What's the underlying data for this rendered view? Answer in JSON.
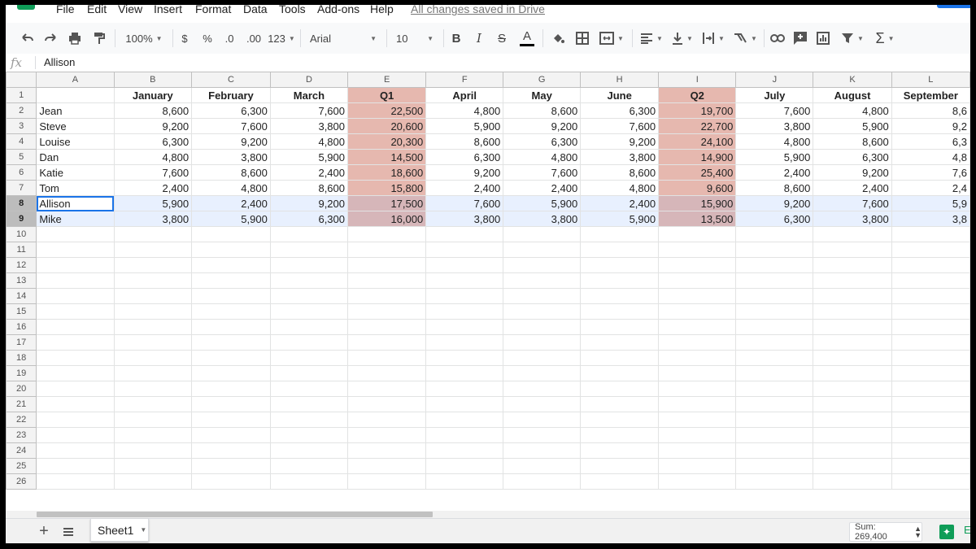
{
  "menu": [
    "File",
    "Edit",
    "View",
    "Insert",
    "Format",
    "Data",
    "Tools",
    "Add-ons",
    "Help"
  ],
  "saved_status": "All changes saved in Drive",
  "toolbar": {
    "zoom": "100%",
    "currency": "$",
    "percent": "%",
    "dec_decrease": ".0",
    "dec_increase": ".00",
    "more_formats": "123",
    "font": "Arial",
    "font_size": "10",
    "bold": "B",
    "italic": "I",
    "strike": "S",
    "text_color": "A",
    "sigma": "Σ"
  },
  "formula_bar": {
    "fx": "fx",
    "value": "Allison"
  },
  "columns": [
    "A",
    "B",
    "C",
    "D",
    "E",
    "F",
    "G",
    "H",
    "I",
    "J",
    "K",
    "L"
  ],
  "header_row": [
    "",
    "January",
    "February",
    "March",
    "Q1",
    "April",
    "May",
    "June",
    "Q2",
    "July",
    "August",
    "September"
  ],
  "rows": [
    [
      "Jean",
      "8,600",
      "6,300",
      "7,600",
      "22,500",
      "4,800",
      "8,600",
      "6,300",
      "19,700",
      "7,600",
      "4,800",
      "8,6"
    ],
    [
      "Steve",
      "9,200",
      "7,600",
      "3,800",
      "20,600",
      "5,900",
      "9,200",
      "7,600",
      "22,700",
      "3,800",
      "5,900",
      "9,2"
    ],
    [
      "Louise",
      "6,300",
      "9,200",
      "4,800",
      "20,300",
      "8,600",
      "6,300",
      "9,200",
      "24,100",
      "4,800",
      "8,600",
      "6,3"
    ],
    [
      "Dan",
      "4,800",
      "3,800",
      "5,900",
      "14,500",
      "6,300",
      "4,800",
      "3,800",
      "14,900",
      "5,900",
      "6,300",
      "4,8"
    ],
    [
      "Katie",
      "7,600",
      "8,600",
      "2,400",
      "18,600",
      "9,200",
      "7,600",
      "8,600",
      "25,400",
      "2,400",
      "9,200",
      "7,6"
    ],
    [
      "Tom",
      "2,400",
      "4,800",
      "8,600",
      "15,800",
      "2,400",
      "2,400",
      "4,800",
      "9,600",
      "8,600",
      "2,400",
      "2,4"
    ],
    [
      "Allison",
      "5,900",
      "2,400",
      "9,200",
      "17,500",
      "7,600",
      "5,900",
      "2,400",
      "15,900",
      "9,200",
      "7,600",
      "5,9"
    ],
    [
      "Mike",
      "3,800",
      "5,900",
      "6,300",
      "16,000",
      "3,800",
      "3,800",
      "5,900",
      "13,500",
      "6,300",
      "3,800",
      "3,8"
    ]
  ],
  "row_numbers": [
    "1",
    "2",
    "3",
    "4",
    "5",
    "6",
    "7",
    "8",
    "9",
    "10",
    "11",
    "12",
    "13",
    "14",
    "15",
    "16",
    "17",
    "18",
    "19",
    "20",
    "21",
    "22",
    "23",
    "24",
    "25",
    "26"
  ],
  "selected_rows": [
    "8",
    "9"
  ],
  "active_cell": "A8",
  "highlight_color": "#e6b8af",
  "sheet_tab": "Sheet1",
  "sum_status": "Sum: 269,400",
  "explore_label": "E"
}
